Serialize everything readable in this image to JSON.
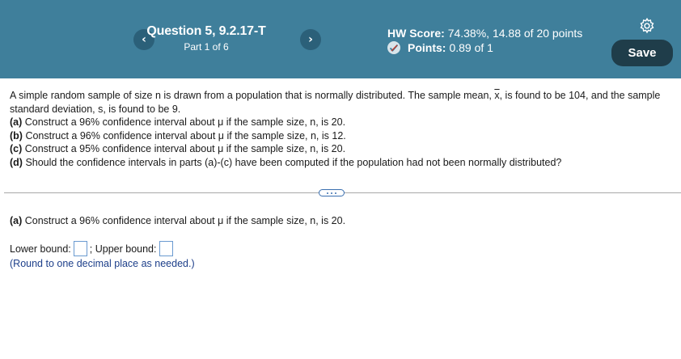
{
  "header": {
    "question_title": "Question 5, 9.2.17-T",
    "part_label": "Part 1 of 6",
    "hw_score_label": "HW Score:",
    "hw_score_value": "74.38%, 14.88 of 20 points",
    "points_label": "Points:",
    "points_value": "0.89 of 1",
    "prev_label": "‹",
    "next_label": "›",
    "save_label": "Save"
  },
  "problem": {
    "intro_1": "A simple random sample of size n is drawn from a population that is normally distributed. The sample mean, ",
    "xbar": "x",
    "intro_2": ", is found to be 104, and the sample standard deviation, s, is found to be 9.",
    "items": [
      {
        "tag": "(a)",
        "text": " Construct a 96% confidence interval about μ if the sample size, n, is 20."
      },
      {
        "tag": "(b)",
        "text": " Construct a 96% confidence interval about μ if the sample size, n, is 12."
      },
      {
        "tag": "(c)",
        "text": " Construct a 95% confidence interval about μ if the sample size, n, is 20."
      },
      {
        "tag": "(d)",
        "text": " Should the confidence intervals in parts (a)-(c) have been computed if the population had not been normally distributed?"
      }
    ]
  },
  "current_part": {
    "tag": "(a)",
    "text": " Construct a 96% confidence interval about μ if the sample size, n, is 20.",
    "lower_label": "Lower bound:",
    "separator": ";",
    "upper_label": "Upper bound:",
    "lower_value": "",
    "upper_value": "",
    "hint": "(Round to one decimal place as needed.)"
  },
  "colors": {
    "header_bg": "#3f7f9b",
    "save_bg": "#1f3d4a",
    "hint_text": "#1d3f8a",
    "input_border": "#6a9ad0"
  },
  "icons": [
    "chevron-left-icon",
    "chevron-right-icon",
    "partial-credit-icon",
    "gear-icon",
    "more-dots-icon"
  ]
}
